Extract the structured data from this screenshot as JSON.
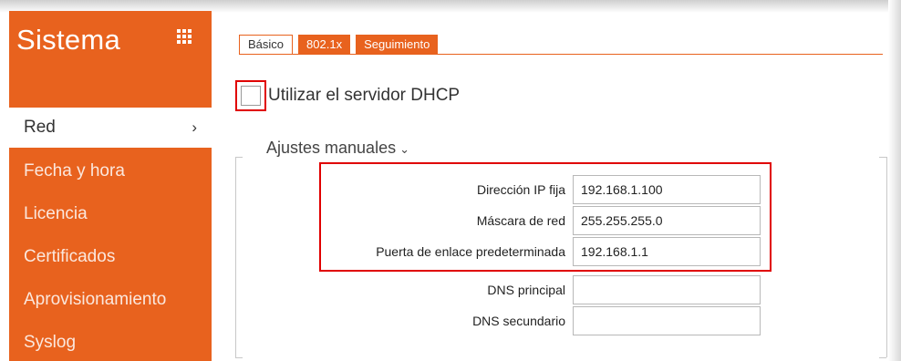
{
  "sidebar": {
    "title": "Sistema",
    "menu_icon": "grid-icon",
    "items": [
      {
        "label": "Red",
        "active": true
      },
      {
        "label": "Fecha y hora"
      },
      {
        "label": "Licencia"
      },
      {
        "label": "Certificados"
      },
      {
        "label": "Aprovisionamiento"
      },
      {
        "label": "Syslog"
      }
    ],
    "active_chevron": "›"
  },
  "tabs": [
    {
      "label": "Básico",
      "active": true
    },
    {
      "label": "802.1x"
    },
    {
      "label": "Seguimiento"
    }
  ],
  "dhcp": {
    "label": "Utilizar el servidor DHCP",
    "checked": false
  },
  "section": {
    "title": "Ajustes manuales",
    "caret": "⌄"
  },
  "fields": [
    {
      "label": "Dirección IP fija",
      "value": "192.168.1.100"
    },
    {
      "label": "Máscara de red",
      "value": "255.255.255.0"
    },
    {
      "label": "Puerta de enlace predeterminada",
      "value": "192.168.1.1"
    },
    {
      "label": "DNS principal",
      "value": ""
    },
    {
      "label": "DNS secundario",
      "value": ""
    }
  ],
  "colors": {
    "accent": "#e8621e",
    "highlight": "#e00000"
  }
}
